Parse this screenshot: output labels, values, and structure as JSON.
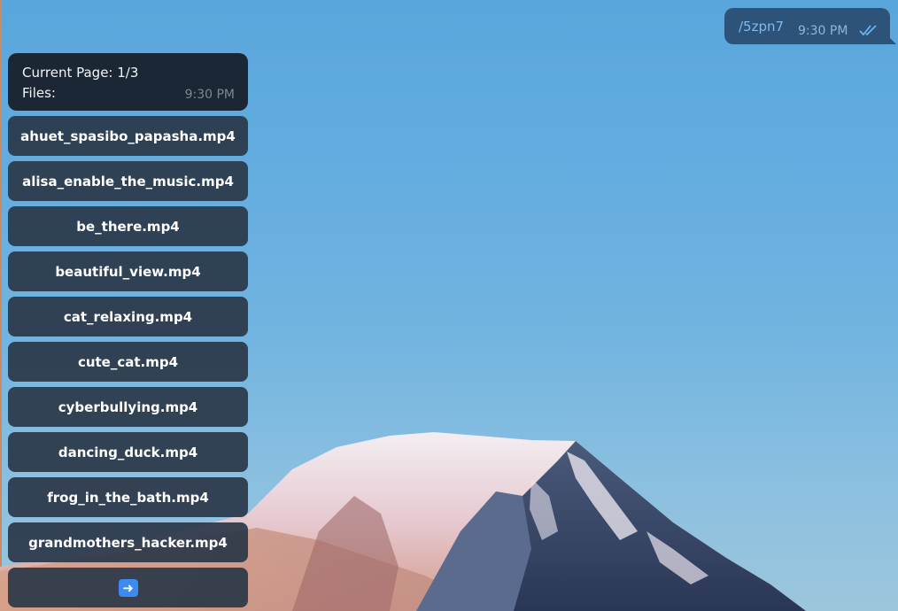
{
  "outgoing": {
    "text": "/5zpn7",
    "time": "9:30 PM",
    "status_icon": "double-check-icon"
  },
  "incoming": {
    "line1": "Current Page: 1/3",
    "line2": "Files:",
    "time": "9:30 PM"
  },
  "keyboard": {
    "buttons": [
      "ahuet_spasibo_papasha.mp4",
      "alisa_enable_the_music.mp4",
      "be_there.mp4",
      "beautiful_view.mp4",
      "cat_relaxing.mp4",
      "cute_cat.mp4",
      "cyberbullying.mp4",
      "dancing_duck.mp4",
      "frog_in_the_bath.mp4",
      "grandmothers_hacker.mp4"
    ],
    "next_icon": "right-arrow-icon"
  },
  "colors": {
    "sky": "#62acdf",
    "outgoing_bubble": "#2e5379",
    "incoming_bubble": "#1c2735",
    "keyboard_button": "#2a3748"
  }
}
